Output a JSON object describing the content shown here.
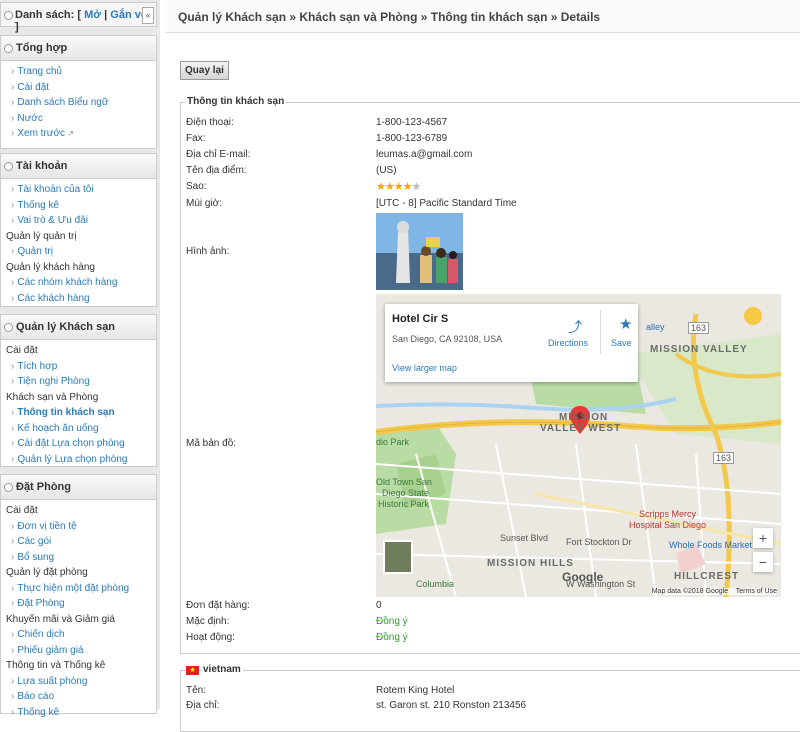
{
  "sidebar": {
    "top": {
      "label": "Danh sách:",
      "open": "Mở",
      "collapse": "Gắn với",
      "collapse_btn": "«"
    },
    "sections": [
      {
        "title": "Tổng hợp",
        "items": [
          {
            "type": "link",
            "label": "Trang chủ"
          },
          {
            "type": "link",
            "label": "Cài đặt"
          },
          {
            "type": "link",
            "label": "Danh sách Biểu ngữ"
          },
          {
            "type": "link",
            "label": "Nước"
          },
          {
            "type": "link",
            "label": "Xem trước",
            "external": true
          }
        ]
      },
      {
        "title": "Tài khoản",
        "items": [
          {
            "type": "link",
            "label": "Tài khoản của tôi"
          },
          {
            "type": "link",
            "label": "Thống kê"
          },
          {
            "type": "link",
            "label": "Vai trò & Ưu đãi"
          },
          {
            "type": "group",
            "label": "Quản lý quản trị"
          },
          {
            "type": "link",
            "label": "Quản trị"
          },
          {
            "type": "group",
            "label": "Quản lý khách hàng"
          },
          {
            "type": "link",
            "label": "Các nhóm khách hàng"
          },
          {
            "type": "link",
            "label": "Các khách hàng"
          }
        ]
      },
      {
        "title": "Quản lý Khách sạn",
        "items": [
          {
            "type": "group",
            "label": "Cài đặt"
          },
          {
            "type": "link",
            "label": "Tích hợp"
          },
          {
            "type": "link",
            "label": "Tiện nghi Phòng"
          },
          {
            "type": "group",
            "label": "Khách sạn và Phòng"
          },
          {
            "type": "link",
            "label": "Thông tin khách sạn",
            "active": true
          },
          {
            "type": "link",
            "label": "Kế hoạch ăn uống"
          },
          {
            "type": "link",
            "label": "Cài đặt Lựa chọn phòng"
          },
          {
            "type": "link",
            "label": "Quản lý Lựa chọn phòng"
          }
        ]
      },
      {
        "title": "Đặt Phòng",
        "items": [
          {
            "type": "group",
            "label": "Cài đặt"
          },
          {
            "type": "link",
            "label": "Đơn vị tiền tệ"
          },
          {
            "type": "link",
            "label": "Các gói"
          },
          {
            "type": "link",
            "label": "Bổ sung"
          },
          {
            "type": "group",
            "label": "Quản lý đặt phòng"
          },
          {
            "type": "link",
            "label": "Thực hiện một đặt phòng"
          },
          {
            "type": "link",
            "label": "Đặt Phòng"
          },
          {
            "type": "group",
            "label": "Khuyến mãi và Giảm giá"
          },
          {
            "type": "link",
            "label": "Chiến dịch"
          },
          {
            "type": "link",
            "label": "Phiếu giảm giá"
          },
          {
            "type": "group",
            "label": "Thông tin và Thống kê"
          },
          {
            "type": "link",
            "label": "Lựa suất phòng"
          },
          {
            "type": "link",
            "label": "Báo cáo"
          },
          {
            "type": "link",
            "label": "Thống kê"
          }
        ]
      }
    ]
  },
  "breadcrumb": "Quản lý Khách sạn » Khách sạn và Phòng » Thông tin khách sạn » Details",
  "back_button": "Quay lại",
  "hotel_info": {
    "legend": "Thông tin khách sạn",
    "fields": [
      {
        "label": "Điện thoại:",
        "value": "1-800-123-4567"
      },
      {
        "label": "Fax:",
        "value": "1-800-123-6789"
      },
      {
        "label": "Địa chỉ E-mail:",
        "value": "leumas.a@gmail.com"
      },
      {
        "label": "Tên địa điểm:",
        "value": "(US)"
      }
    ],
    "stars_label": "Sao:",
    "stars": 4,
    "stars_max": 5,
    "timezone_label": "Múi giờ:",
    "timezone": "[UTC - 8] Pacific Standard Time",
    "image_label": "Hình ảnh:",
    "map_label": "Mã bản đồ:",
    "order_label": "Đơn đặt hàng:",
    "order_value": "0",
    "default_label": "Mặc định:",
    "default_value": "Đồng ý",
    "active_label": "Hoạt động:",
    "active_value": "Đồng ý"
  },
  "map": {
    "name": "Hotel Cir S",
    "address": "San Diego, CA 92108, USA",
    "larger": "View larger map",
    "directions": "Directions",
    "save": "Save",
    "labels": {
      "mission_valley": "MISSION VALLEY",
      "mission": "MISSION",
      "valley_west": "VALLEY WEST",
      "old_town": "Old Town San",
      "diego_state": "Diego State",
      "historic_park": "Historic Park",
      "mission_hills": "MISSION HILLS",
      "hillcrest": "HILLCREST",
      "scripps": "Scripps Mercy",
      "hospital": "Hospital San Diego",
      "whole_foods": "Whole Foods Market",
      "sunset_blvd": "Sunset Blvd",
      "fort_stockton": "Fort Stockton Dr",
      "columbia": "Columbia",
      "washington": "W Washington St",
      "dio_park": "dio Park",
      "hwy163a": "163",
      "hwy163b": "163",
      "valley_frag": "alley"
    },
    "google": "Google",
    "footer_data": "Map data ©2018 Google",
    "footer_terms": "Terms of Use",
    "zoom_in": "+",
    "zoom_out": "−"
  },
  "vietnam": {
    "legend": "vietnam",
    "name_label": "Tên:",
    "name_value": "Rotem King Hotel",
    "address_label": "Địa chỉ:",
    "address_value": "st. Garon st. 210 Ronston 213456"
  },
  "colors": {
    "link": "#2a7ab8",
    "green": "#2a9a2a",
    "star": "#f4a300"
  }
}
